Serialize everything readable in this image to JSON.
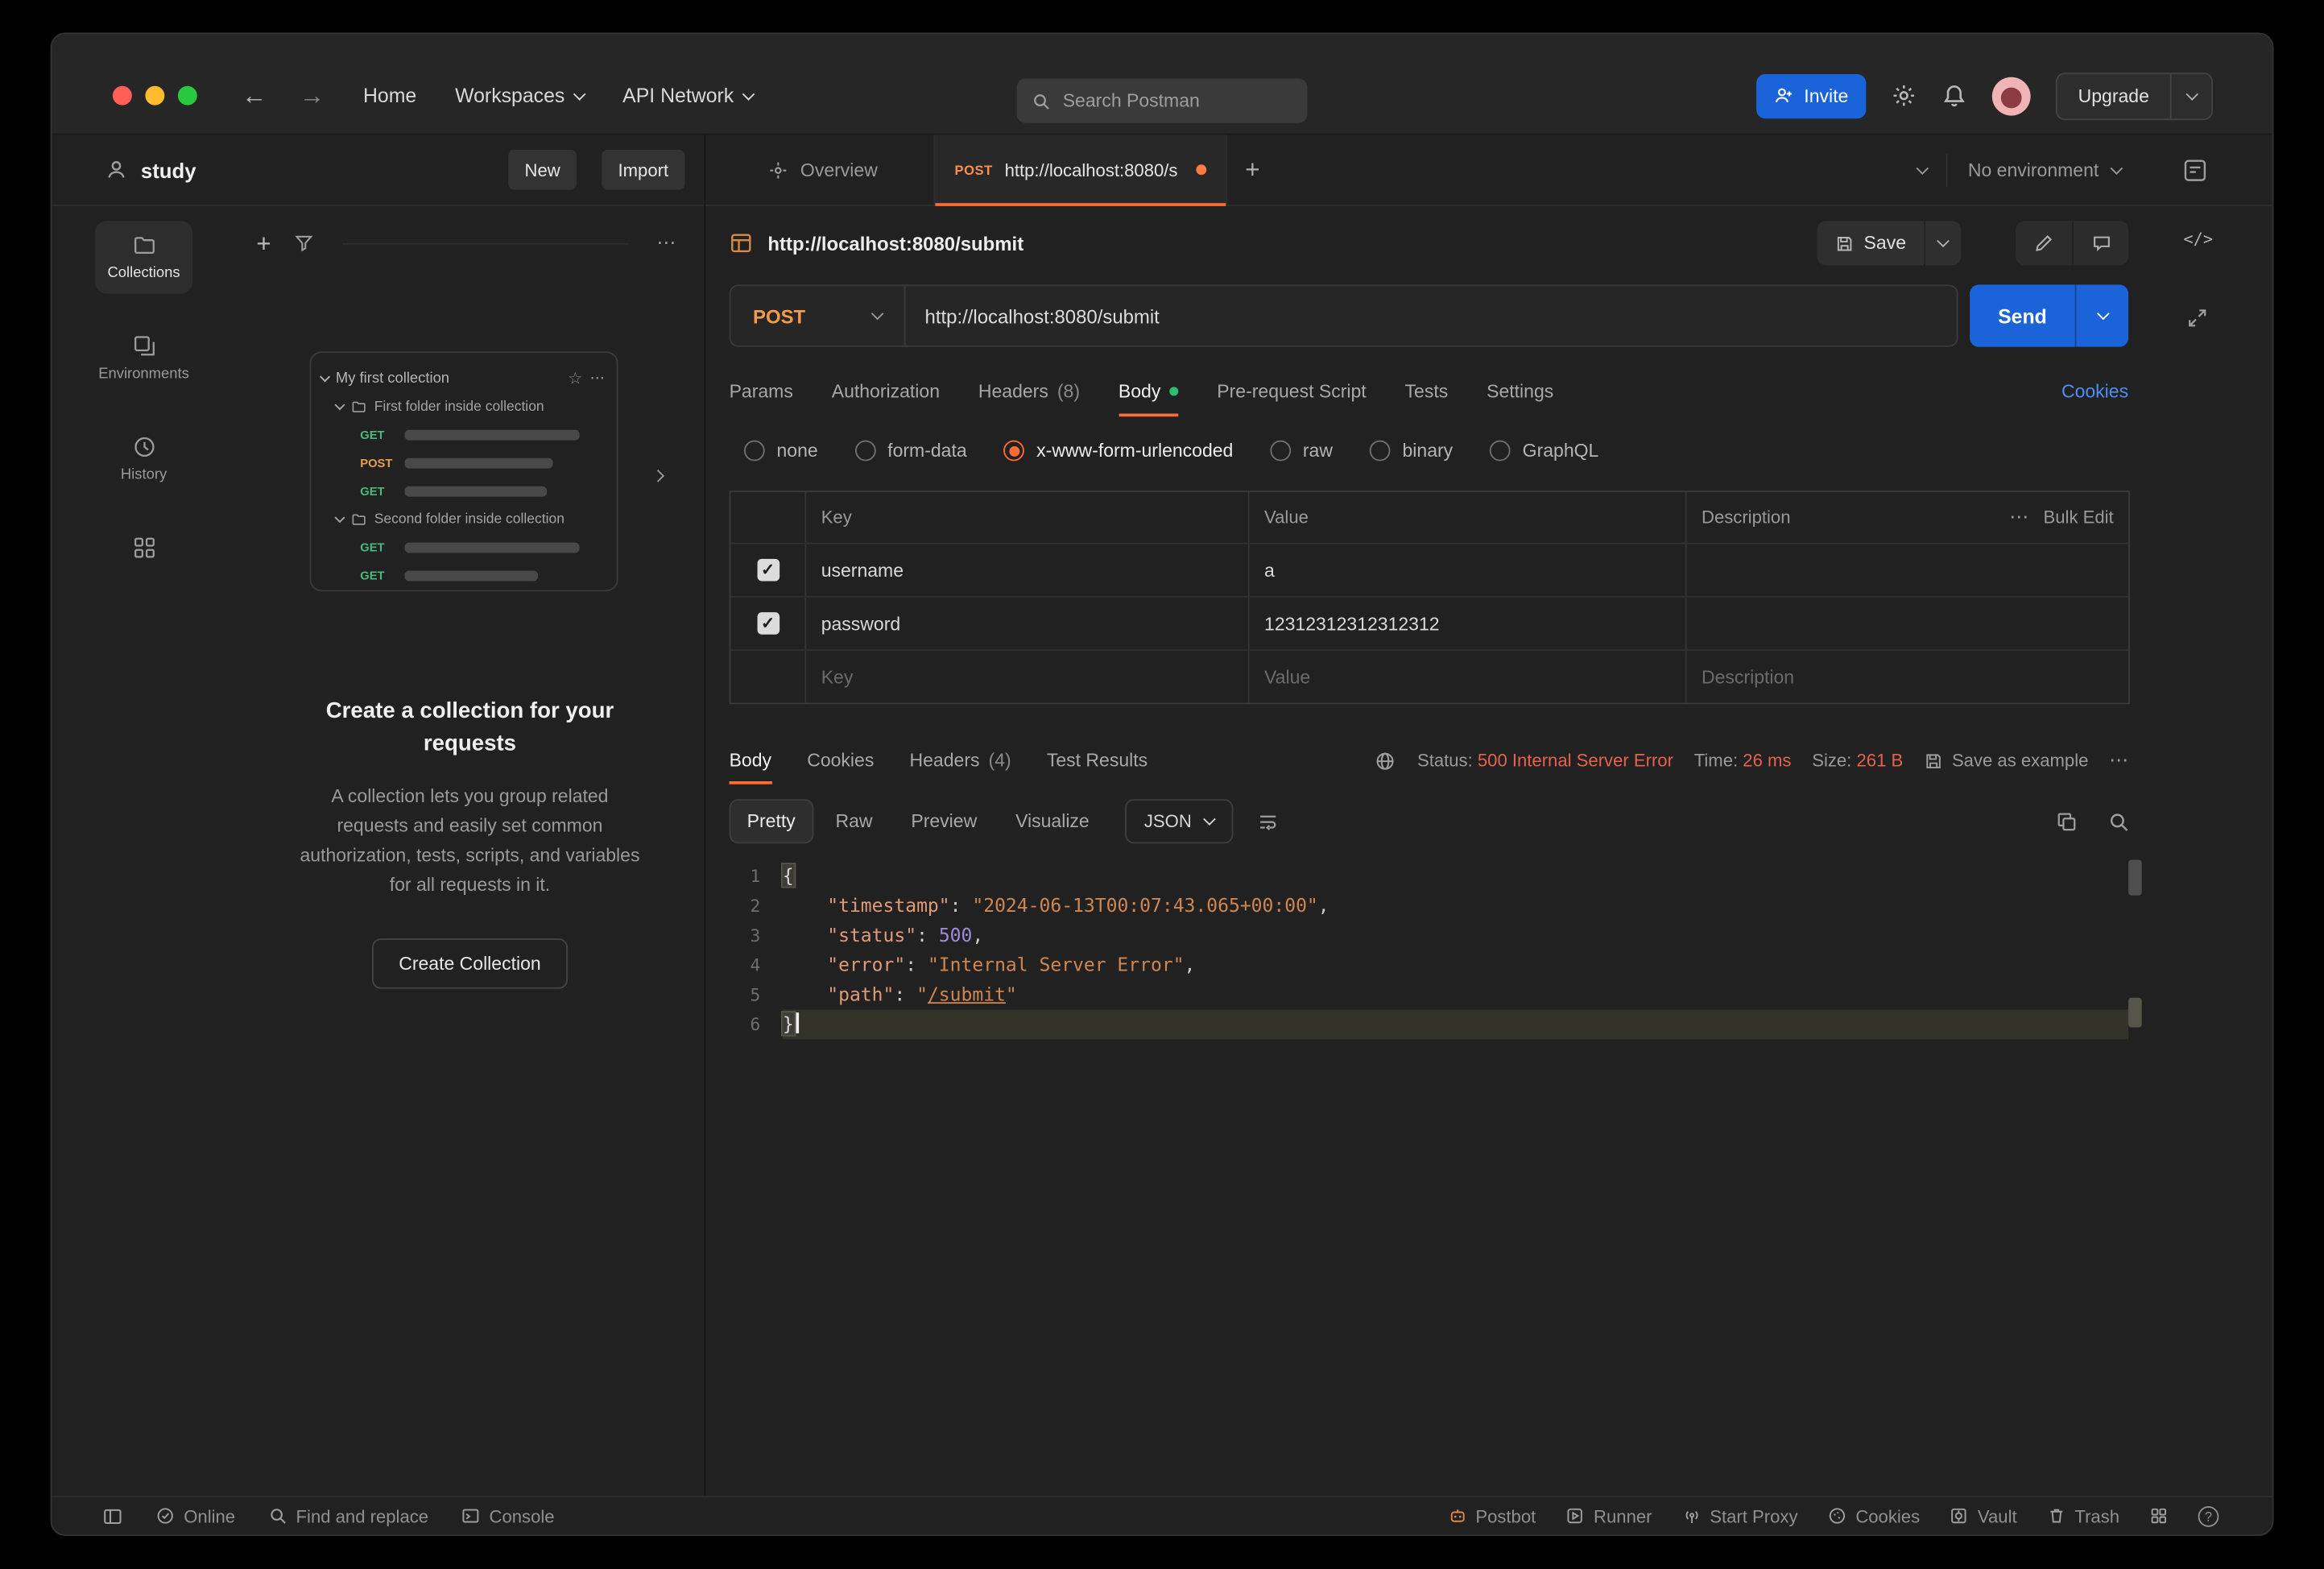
{
  "icons": {
    "back": "←",
    "forward": "→",
    "plus": "+",
    "star": "☆",
    "more": "⋯",
    "code": "</>",
    "help": "?"
  },
  "header": {
    "nav_home": "Home",
    "nav_workspaces": "Workspaces",
    "nav_api_network": "API Network",
    "search_placeholder": "Search Postman",
    "invite": "Invite",
    "upgrade": "Upgrade"
  },
  "sidebar": {
    "workspace": "study",
    "new": "New",
    "import": "Import",
    "rail_collections": "Collections",
    "rail_environments": "Environments",
    "rail_history": "History",
    "tree": {
      "collection": "My first collection",
      "folder1": "First folder inside collection",
      "folder2": "Second folder inside collection",
      "m1": "GET",
      "m2": "POST",
      "m3": "GET",
      "m4": "GET",
      "m5": "GET"
    },
    "empty": {
      "title": "Create a collection for your requests",
      "body": "A collection lets you group related requests and easily set common authorization, tests, scripts, and variables for all requests in it.",
      "button": "Create Collection"
    }
  },
  "tabs": {
    "overview": "Overview",
    "active_method": "POST",
    "active_title": "http://localhost:8080/s",
    "environment": "No environment"
  },
  "request": {
    "title": "http://localhost:8080/submit",
    "save": "Save",
    "method": "POST",
    "url": "http://localhost:8080/submit",
    "send": "Send",
    "tab_params": "Params",
    "tab_auth": "Authorization",
    "tab_headers": "Headers",
    "tab_headers_count": "(8)",
    "tab_body": "Body",
    "tab_prerequest": "Pre-request Script",
    "tab_tests": "Tests",
    "tab_settings": "Settings",
    "cookies": "Cookies",
    "modes": {
      "none": "none",
      "form_data": "form-data",
      "urlencoded": "x-www-form-urlencoded",
      "raw": "raw",
      "binary": "binary",
      "graphql": "GraphQL"
    },
    "table": {
      "col_key": "Key",
      "col_value": "Value",
      "col_desc": "Description",
      "bulk_edit": "Bulk Edit",
      "rows": [
        {
          "key": "username",
          "value": "a"
        },
        {
          "key": "password",
          "value": "12312312312312312"
        }
      ],
      "ph_key": "Key",
      "ph_value": "Value",
      "ph_desc": "Description"
    }
  },
  "response": {
    "tab_body": "Body",
    "tab_cookies": "Cookies",
    "tab_headers": "Headers",
    "tab_headers_count": "(4)",
    "tab_tests": "Test Results",
    "status_label": "Status:",
    "status_value": "500 Internal Server Error",
    "time_label": "Time:",
    "time_value": "26 ms",
    "size_label": "Size:",
    "size_value": "261 B",
    "save_example": "Save as example",
    "view_pretty": "Pretty",
    "view_raw": "Raw",
    "view_preview": "Preview",
    "view_visualize": "Visualize",
    "format": "JSON",
    "code_lines": [
      {
        "tokens": [
          {
            "t": "{",
            "c": "brace"
          }
        ]
      },
      {
        "tokens": [
          {
            "t": "    ",
            "c": "punc"
          },
          {
            "t": "\"timestamp\"",
            "c": "key"
          },
          {
            "t": ":",
            "c": "punc"
          },
          {
            "t": " ",
            "c": "punc"
          },
          {
            "t": "\"2024-06-13T00:07:43.065+00:00\"",
            "c": "str"
          },
          {
            "t": ",",
            "c": "punc"
          }
        ]
      },
      {
        "tokens": [
          {
            "t": "    ",
            "c": "punc"
          },
          {
            "t": "\"status\"",
            "c": "key"
          },
          {
            "t": ":",
            "c": "punc"
          },
          {
            "t": " ",
            "c": "punc"
          },
          {
            "t": "500",
            "c": "num"
          },
          {
            "t": ",",
            "c": "punc"
          }
        ]
      },
      {
        "tokens": [
          {
            "t": "    ",
            "c": "punc"
          },
          {
            "t": "\"error\"",
            "c": "key"
          },
          {
            "t": ":",
            "c": "punc"
          },
          {
            "t": " ",
            "c": "punc"
          },
          {
            "t": "\"Internal Server Error\"",
            "c": "str"
          },
          {
            "t": ",",
            "c": "punc"
          }
        ]
      },
      {
        "tokens": [
          {
            "t": "    ",
            "c": "punc"
          },
          {
            "t": "\"path\"",
            "c": "key"
          },
          {
            "t": ":",
            "c": "punc"
          },
          {
            "t": " ",
            "c": "punc"
          },
          {
            "t": "\"",
            "c": "str"
          },
          {
            "t": "/submit",
            "c": "link"
          },
          {
            "t": "\"",
            "c": "str"
          }
        ]
      },
      {
        "tokens": [
          {
            "t": "}",
            "c": "brace"
          }
        ],
        "highlight": true,
        "cursor": true
      }
    ]
  },
  "footer": {
    "online": "Online",
    "find_replace": "Find and replace",
    "console": "Console",
    "postbot": "Postbot",
    "runner": "Runner",
    "start_proxy": "Start Proxy",
    "cookies": "Cookies",
    "vault": "Vault",
    "trash": "Trash"
  }
}
